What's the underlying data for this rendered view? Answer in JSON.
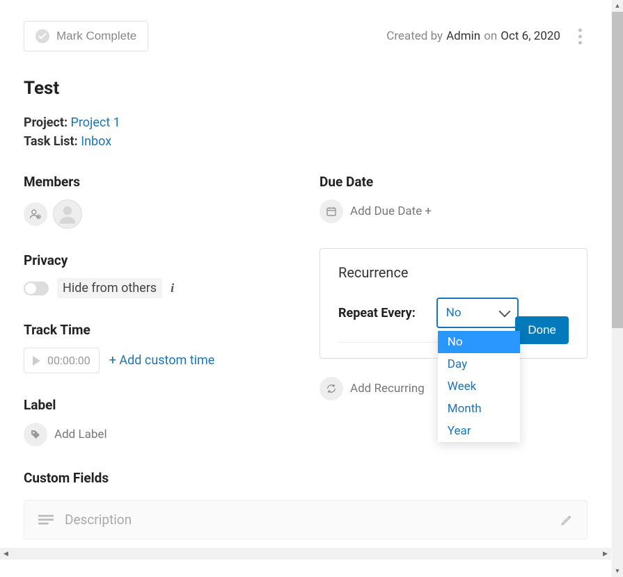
{
  "header": {
    "mark_complete_label": "Mark Complete",
    "created_by_prefix": "Created by",
    "created_by_user": "Admin",
    "created_by_on": "on",
    "created_by_date": "Oct 6, 2020"
  },
  "task": {
    "title": "Test",
    "project_label": "Project:",
    "project_name": "Project 1",
    "task_list_label": "Task List:",
    "task_list_name": "Inbox"
  },
  "sections": {
    "members_heading": "Members",
    "privacy_heading": "Privacy",
    "hide_from_others": "Hide from others",
    "track_time_heading": "Track Time",
    "timer_value": "00:00:00",
    "add_custom_time": "+ Add custom time",
    "label_heading": "Label",
    "add_label": "Add Label",
    "custom_fields_heading": "Custom Fields",
    "description_placeholder": "Description"
  },
  "due": {
    "heading": "Due Date",
    "add_due_date": "Add Due Date +"
  },
  "recurrence": {
    "panel_heading": "Recurrence",
    "repeat_label": "Repeat Every:",
    "selected": "No",
    "options": [
      "No",
      "Day",
      "Week",
      "Month",
      "Year"
    ],
    "done_label": "Done"
  },
  "recurring": {
    "heading_partial": "Recurring",
    "add_recurring": "Add Recurring"
  }
}
